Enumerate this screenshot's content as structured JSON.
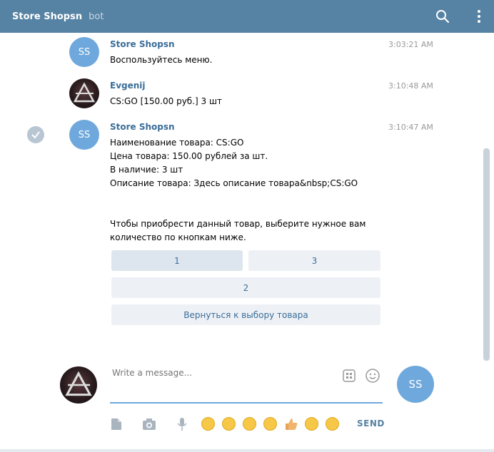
{
  "header": {
    "title": "Store Shopsn",
    "subtitle": "bot"
  },
  "messages": [
    {
      "author": "Store Shopsn",
      "initials": "SS",
      "time": "3:03:21 AM",
      "text": "Воспользуйтесь меню."
    },
    {
      "author": "Evgenij",
      "time": "3:10:48 AM",
      "text": "CS:GO [150.00 руб.] 3 шт"
    },
    {
      "author": "Store Shopsn",
      "initials": "SS",
      "time": "3:10:47 AM",
      "lines": [
        "Наименование товара: CS:GO",
        "Цена товара: 150.00 рублей за шт.",
        "В наличие: 3 шт",
        "Описание товара: Здесь описание товара&nbsp;CS:GO",
        "",
        "",
        "Чтобы приобрести данный товар, выберите нужное вам",
        "количество по кнопкам ниже."
      ],
      "keyboard": [
        "1",
        "3",
        "2",
        "Вернуться к выбору товара"
      ]
    }
  ],
  "compose": {
    "placeholder": "Write a message...",
    "send_label": "SEND",
    "my_initials": "SS"
  }
}
